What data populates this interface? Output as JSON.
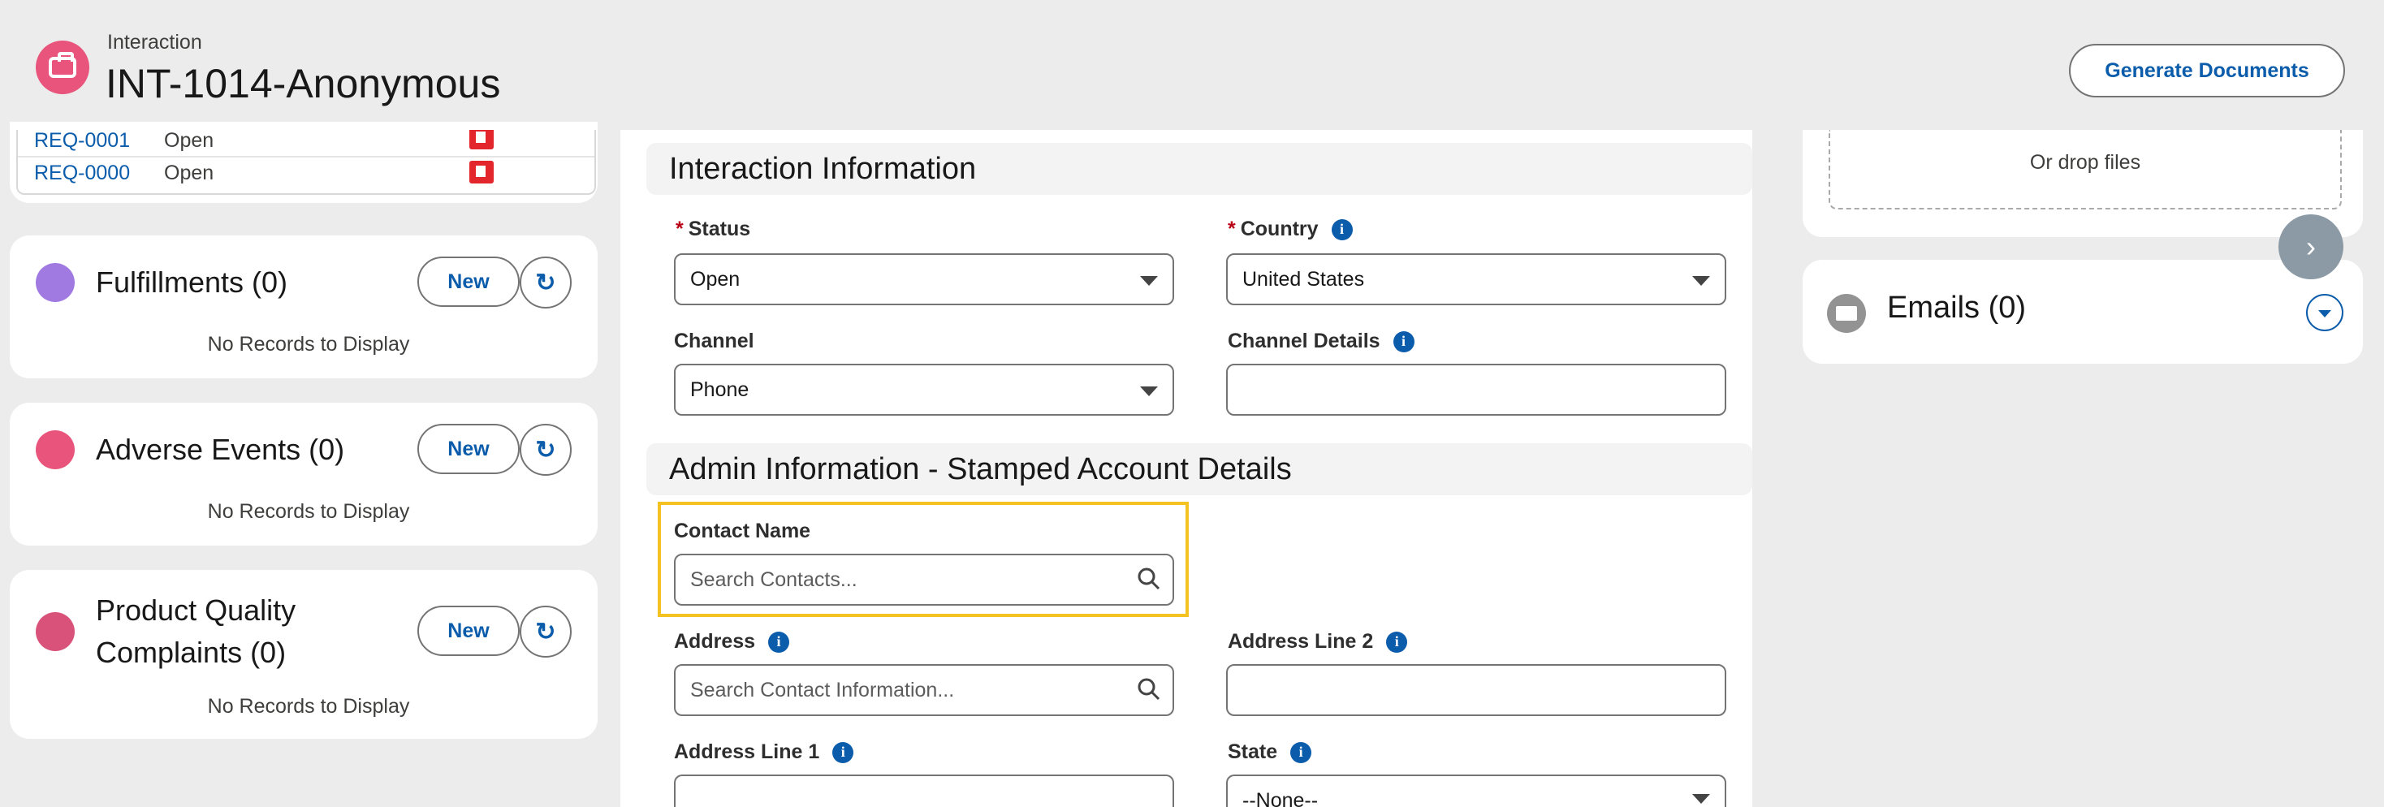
{
  "header": {
    "object_label": "Interaction",
    "record_title": "INT-1014-Anonymous",
    "generate_button": "Generate Documents"
  },
  "requests": [
    {
      "id": "REQ-0001",
      "status": "Open"
    },
    {
      "id": "REQ-0000",
      "status": "Open"
    }
  ],
  "related_lists": [
    {
      "title": "Fulfillments (0)",
      "new_label": "New",
      "empty": "No Records to Display",
      "icon": "envelope-icon",
      "color": "#a07ae0"
    },
    {
      "title": "Adverse Events (0)",
      "new_label": "New",
      "empty": "No Records to Display",
      "icon": "camera-icon",
      "color": "#e8547b"
    },
    {
      "title_line1": "Product Quality",
      "title_line2": "Complaints (0)",
      "new_label": "New",
      "empty": "No Records to Display",
      "icon": "ticket-icon",
      "color": "#d9527a"
    }
  ],
  "form": {
    "section1": "Interaction Information",
    "section2": "Admin Information - Stamped Account Details",
    "status_label": "Status",
    "status_value": "Open",
    "country_label": "Country",
    "country_value": "United States",
    "channel_label": "Channel",
    "channel_value": "Phone",
    "channel_details_label": "Channel Details",
    "contact_name_label": "Contact Name",
    "contact_name_placeholder": "Search Contacts...",
    "address_label": "Address",
    "address_placeholder": "Search Contact Information...",
    "address_line2_label": "Address Line 2",
    "address_line1_label": "Address Line 1",
    "state_label": "State",
    "state_value": "--None--"
  },
  "right": {
    "drop_text": "Or drop files",
    "emails_title": "Emails (0)"
  },
  "colors": {
    "brand_blue": "#0b5cab",
    "required": "#ba0517",
    "highlight": "#f4c321"
  }
}
